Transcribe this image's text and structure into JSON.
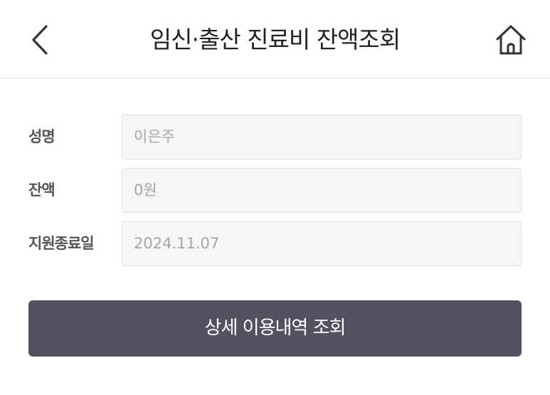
{
  "header": {
    "title": "임신·출산 진료비 잔액조회",
    "back_icon": "chevron-left-icon",
    "home_icon": "home-icon"
  },
  "form": {
    "rows": [
      {
        "label": "성명",
        "value": "이은주"
      },
      {
        "label": "잔액",
        "value": "0원"
      },
      {
        "label": "지원종료일",
        "value": "2024.11.07"
      }
    ]
  },
  "actions": {
    "detail_button_label": "상세 이용내역 조회"
  },
  "colors": {
    "button_bg": "#545260",
    "field_bg": "#f6f6f6",
    "field_text": "#a6a6a6",
    "label_text": "#555555",
    "title_text": "#222222"
  }
}
